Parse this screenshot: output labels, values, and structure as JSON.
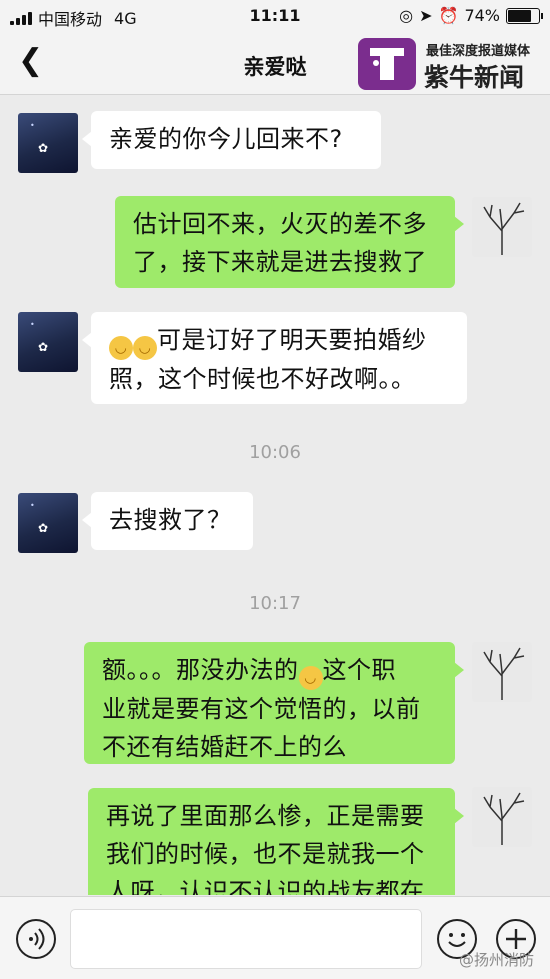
{
  "status": {
    "carrier": "中国移动",
    "network": "4G",
    "time": "11:11",
    "battery": "74%",
    "battery_level": 0.74
  },
  "header": {
    "back_icon": "chevron-left-icon",
    "title": "亲爱哒"
  },
  "brand": {
    "tagline": "最佳深度报道媒体",
    "name": "紫牛新闻"
  },
  "messages": [
    {
      "sender": "other",
      "text": "亲爱的你今儿回来不?"
    },
    {
      "sender": "self",
      "line1": "估计回不来，火灭的差不多",
      "line2": "了，接下来就是进去搜救了"
    },
    {
      "sender": "other",
      "line1": "可是订好了明天要拍婚纱",
      "line2": "照，这个时候也不好改啊。。"
    },
    {
      "time": "10:06"
    },
    {
      "sender": "other",
      "text": "去搜救了？"
    },
    {
      "time": "10:17"
    },
    {
      "sender": "self",
      "line1a": "额。。。那没办法的",
      "line1b": "这个职",
      "line2": "业就是要有这个觉悟的，以前",
      "line3": "不还有结婚赶不上的么"
    },
    {
      "sender": "self",
      "line1": "再说了里面那么惨，正是需要",
      "line2": "我们的时候，也不是就我一个",
      "line3": "人呀，认识不认识的战友都在"
    }
  ],
  "input": {
    "voice_icon": "voice-icon",
    "emoji_icon": "emoji-icon",
    "plus_icon": "plus-icon"
  },
  "watermark": "@扬州消防"
}
